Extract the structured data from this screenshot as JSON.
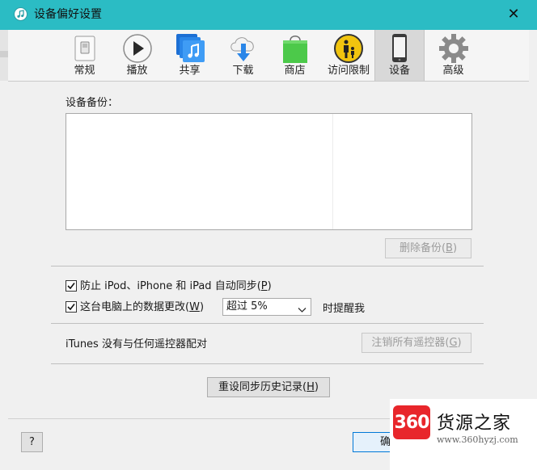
{
  "window": {
    "title": "设备偏好设置",
    "close_glyph": "✕"
  },
  "toolbar": {
    "tabs": [
      {
        "label": "常规",
        "icon": "general-switch-icon"
      },
      {
        "label": "播放",
        "icon": "play-icon"
      },
      {
        "label": "共享",
        "icon": "sharing-music-icon"
      },
      {
        "label": "下载",
        "icon": "cloud-download-icon"
      },
      {
        "label": "商店",
        "icon": "store-bag-icon"
      },
      {
        "label": "访问限制",
        "icon": "parental-restrictions-icon"
      },
      {
        "label": "设备",
        "icon": "iphone-device-icon"
      },
      {
        "label": "高级",
        "icon": "gear-icon"
      }
    ],
    "active_tab": "设备"
  },
  "backup": {
    "section_label": "设备备份：",
    "delete_button": {
      "label": "删除备份(",
      "key": "B",
      "suffix": ")"
    }
  },
  "options": {
    "prevent_sync": {
      "checked": true,
      "label": "防止 iPod、iPhone 和 iPad 自动同步(",
      "key": "P",
      "suffix": ")"
    },
    "data_change": {
      "checked": true,
      "label": "这台电脑上的数据更改(",
      "key": "W",
      "suffix": ")"
    },
    "threshold_select": {
      "value": "超过 5%"
    },
    "remind_text": "时提醒我"
  },
  "remote": {
    "status_text": "iTunes 没有与任何遥控器配对",
    "deauth_button": {
      "label": "注销所有遥控器(",
      "key": "G",
      "suffix": ")"
    }
  },
  "reset_sync": {
    "label": "重设同步历史记录(",
    "key": "H",
    "suffix": ")"
  },
  "footer": {
    "help_label": "?",
    "ok_label": "确"
  },
  "watermark": {
    "badge": "360",
    "name": "货源之家",
    "url": "www.360hyzj.com"
  },
  "colors": {
    "titlebar": "#2bbcc4",
    "window_bg": "#f0f0f0",
    "primary_button_border": "#0078d7"
  }
}
